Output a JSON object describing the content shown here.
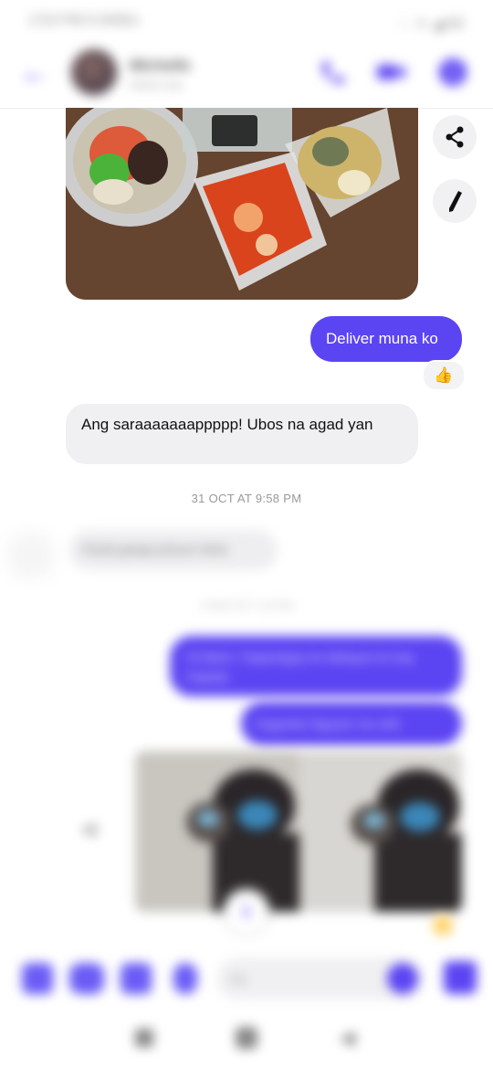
{
  "status_bar": {
    "time": "2:53 PM 0.0KB/s",
    "right": "⋮ ᯤ ◢ 80"
  },
  "header": {
    "contact_name": "Michelle",
    "contact_sub": "Active now"
  },
  "messages": {
    "outgoing_1": "Deliver muna ko",
    "reaction_1": "👍",
    "incoming_1": "Ang saraaaaaaappppp! Ubos na agad yan",
    "timestamp_1": "31 OCT AT 9:58 PM",
    "incoming_blur": "Pandi ganga picture hehe",
    "timestamp_blur": "2 NOV AT 7:14 PM",
    "outgoing_blur_1": "Hi Mam!. Papamigay ko kabayan ko kay Fabella",
    "outgoing_blur_2": "Kagandu Nguyen mo ahh"
  },
  "composer": {
    "placeholder": "Aa"
  },
  "colors": {
    "accent": "#5b44f2",
    "bubble_in": "#f0f0f2"
  }
}
